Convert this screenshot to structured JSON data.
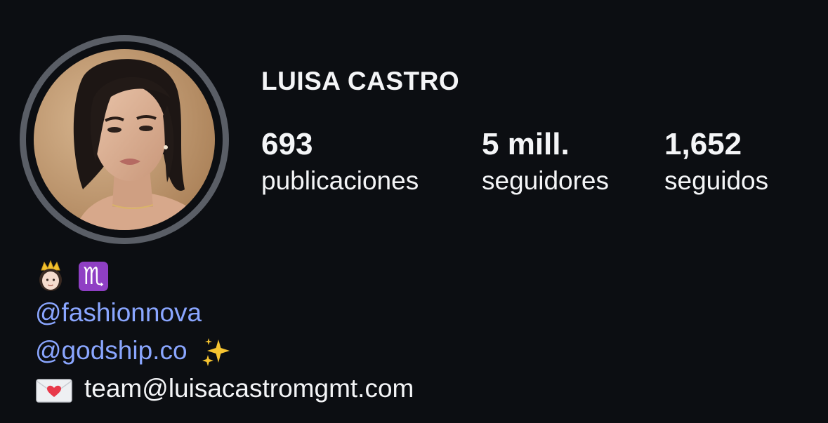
{
  "profile": {
    "name": "LUISA CASTRO",
    "stats": {
      "posts": {
        "value": "693",
        "label": "publicaciones"
      },
      "followers": {
        "value": "5 mill.",
        "label": "seguidores"
      },
      "following": {
        "value": "1,652",
        "label": "seguidos"
      }
    },
    "bio": {
      "emoji_line": {
        "icons": [
          "princess-emoji-icon",
          "scorpio-sign-icon"
        ],
        "sign_glyph": "♏"
      },
      "mention_1": "@fashionnova",
      "mention_2": "@godship.co",
      "sparkle_icon": "sparkles-emoji-icon",
      "email_icon": "love-letter-emoji-icon",
      "email": "team@luisacastromgmt.com"
    }
  },
  "colors": {
    "background": "#0c0e12",
    "text": "#f4f5f7",
    "mention": "#8aa6ff",
    "ring": "#5a5e66",
    "scorpio_box": "#8f3fc4"
  }
}
